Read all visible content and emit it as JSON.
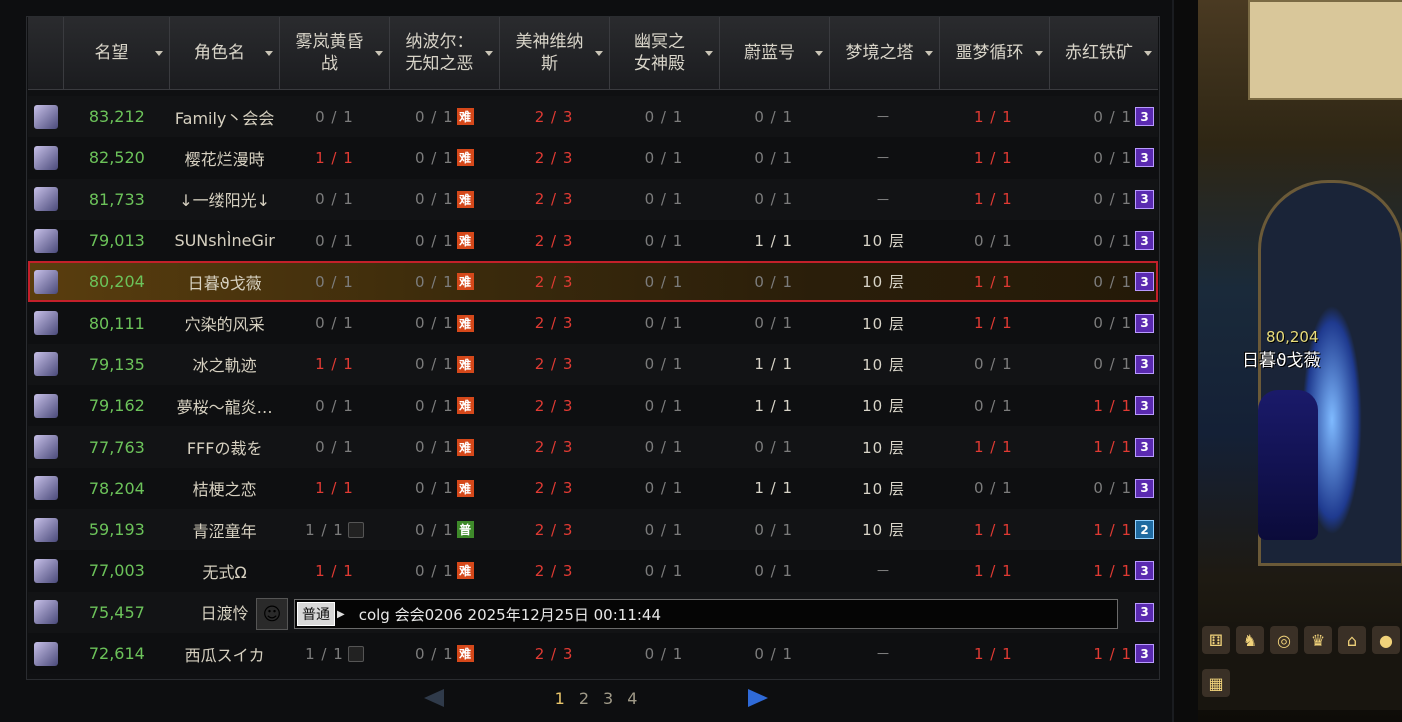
{
  "header": {
    "columns": [
      {
        "label": "名望"
      },
      {
        "label": "角色名"
      },
      {
        "label": "雾岚黄昏\n战"
      },
      {
        "label": "纳波尔：\n无知之恶"
      },
      {
        "label": "美神维纳\n斯"
      },
      {
        "label": "幽冥之\n女神殿"
      },
      {
        "label": "蔚蓝号"
      },
      {
        "label": "梦境之塔"
      },
      {
        "label": "噩梦循环"
      },
      {
        "label": "赤红铁矿"
      }
    ]
  },
  "rows": [
    {
      "rep": "83,212",
      "name": "Family丶会会",
      "d1": "0 / 1",
      "d2": "0 / 1",
      "d2b": "难",
      "d3": "2 / 3",
      "d4": "0 / 1",
      "d5": "0 / 1",
      "d6": "－",
      "d7": "1 / 1",
      "d8": "0 / 1",
      "d8b": "3"
    },
    {
      "rep": "82,520",
      "name": "樱花烂漫時",
      "d1": "1 / 1",
      "d2": "0 / 1",
      "d2b": "难",
      "d3": "2 / 3",
      "d4": "0 / 1",
      "d5": "0 / 1",
      "d6": "－",
      "d7": "1 / 1",
      "d8": "0 / 1",
      "d8b": "3"
    },
    {
      "rep": "81,733",
      "name": "↓一缕阳光↓",
      "d1": "0 / 1",
      "d2": "0 / 1",
      "d2b": "难",
      "d3": "2 / 3",
      "d4": "0 / 1",
      "d5": "0 / 1",
      "d6": "－",
      "d7": "1 / 1",
      "d8": "0 / 1",
      "d8b": "3"
    },
    {
      "rep": "79,013",
      "name": "SUNshÌneGir",
      "d1": "0 / 1",
      "d2": "0 / 1",
      "d2b": "难",
      "d3": "2 / 3",
      "d4": "0 / 1",
      "d5": "1 / 1",
      "d6": "10 层",
      "d7": "0 / 1",
      "d8": "0 / 1",
      "d8b": "3"
    },
    {
      "rep": "80,204",
      "name": "日暮ϑ戈薇",
      "d1": "0 / 1",
      "d2": "0 / 1",
      "d2b": "难",
      "d3": "2 / 3",
      "d4": "0 / 1",
      "d5": "0 / 1",
      "d6": "10 层",
      "d7": "1 / 1",
      "d8": "0 / 1",
      "d8b": "3",
      "highlight": true
    },
    {
      "rep": "80,111",
      "name": "穴染的风采",
      "d1": "0 / 1",
      "d2": "0 / 1",
      "d2b": "难",
      "d3": "2 / 3",
      "d4": "0 / 1",
      "d5": "0 / 1",
      "d6": "10 层",
      "d7": "1 / 1",
      "d8": "0 / 1",
      "d8b": "3"
    },
    {
      "rep": "79,135",
      "name": "冰之軌迹",
      "d1": "1 / 1",
      "d2": "0 / 1",
      "d2b": "难",
      "d3": "2 / 3",
      "d4": "0 / 1",
      "d5": "1 / 1",
      "d6": "10 层",
      "d7": "0 / 1",
      "d8": "0 / 1",
      "d8b": "3"
    },
    {
      "rep": "79,162",
      "name": "夢桜～龍炎…",
      "d1": "0 / 1",
      "d2": "0 / 1",
      "d2b": "难",
      "d3": "2 / 3",
      "d4": "0 / 1",
      "d5": "1 / 1",
      "d6": "10 层",
      "d7": "0 / 1",
      "d8": "1 / 1",
      "d8b": "3"
    },
    {
      "rep": "77,763",
      "name": "FFFの裁を",
      "d1": "0 / 1",
      "d2": "0 / 1",
      "d2b": "难",
      "d3": "2 / 3",
      "d4": "0 / 1",
      "d5": "0 / 1",
      "d6": "10 层",
      "d7": "1 / 1",
      "d8": "1 / 1",
      "d8b": "3"
    },
    {
      "rep": "78,204",
      "name": "桔梗之恋",
      "d1": "1 / 1",
      "d2": "0 / 1",
      "d2b": "难",
      "d3": "2 / 3",
      "d4": "0 / 1",
      "d5": "1 / 1",
      "d6": "10 层",
      "d7": "0 / 1",
      "d8": "0 / 1",
      "d8b": "3"
    },
    {
      "rep": "59,193",
      "name": "青涩童年",
      "d1": "1 / 1",
      "d1lock": true,
      "d2": "0 / 1",
      "d2b": "普",
      "d3": "2 / 3",
      "d4": "0 / 1",
      "d5": "0 / 1",
      "d6": "10 层",
      "d7": "1 / 1",
      "d8": "1 / 1",
      "d8b": "2"
    },
    {
      "rep": "77,003",
      "name": "无式Ω",
      "d1": "1 / 1",
      "d2": "0 / 1",
      "d2b": "难",
      "d3": "2 / 3",
      "d4": "0 / 1",
      "d5": "0 / 1",
      "d6": "－",
      "d7": "1 / 1",
      "d8": "1 / 1",
      "d8b": "3"
    },
    {
      "rep": "75,457",
      "name": "日渡怜",
      "chat": true,
      "d8b": "3"
    },
    {
      "rep": "72,614",
      "name": "西瓜スイカ",
      "d1": "1 / 1",
      "d1lock": true,
      "d2": "0 / 1",
      "d2b": "难",
      "d3": "2 / 3",
      "d4": "0 / 1",
      "d5": "0 / 1",
      "d6": "－",
      "d7": "1 / 1",
      "d8": "1 / 1",
      "d8b": "3"
    }
  ],
  "chat": {
    "channel": "普通",
    "text": "colg 会会0206 2025年12月25日 00:11:44"
  },
  "pager": {
    "pages": [
      "1",
      "2",
      "3",
      "4"
    ],
    "current": "1"
  },
  "scene": {
    "player_rep": "80,204",
    "player_name": "日暮ϑ戈薇"
  }
}
